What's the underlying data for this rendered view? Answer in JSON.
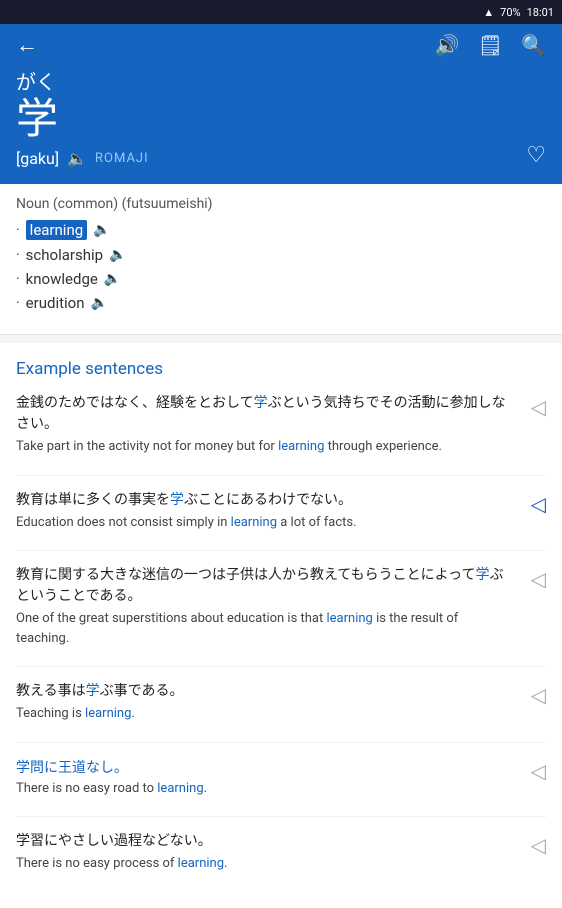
{
  "statusBar": {
    "wifi": "wifi",
    "battery": "70%",
    "time": "18:01"
  },
  "header": {
    "hiragana": "がく",
    "kanji": "学",
    "romaji_bracket": "[gaku]",
    "romaji_label": "ROMAJI"
  },
  "definitions": {
    "pos": "Noun (common) (futsuumeishi)",
    "items": [
      {
        "word": "learning",
        "highlight": true
      },
      {
        "word": "scholarship"
      },
      {
        "word": "knowledge"
      },
      {
        "word": "erudition"
      }
    ]
  },
  "examples": {
    "title": "Example sentences",
    "items": [
      {
        "jp": "金銭のためではなく、経験をとおして学ぶという気持ちでその活動に参加しなさい。",
        "en_pre": "Take part in the activity not for money but for ",
        "en_link": "learning",
        "en_post": " through experience.",
        "audio_active": false
      },
      {
        "jp": "教育は単に多くの事実を学ぶことにあるわけでない。",
        "en_pre": "Education does not consist simply in ",
        "en_link": "learning",
        "en_post": " a lot of facts.",
        "audio_active": true
      },
      {
        "jp": "教育に関する大きな迷信の一つは子供は人から教えてもらうことによって学ぶということである。",
        "en_pre": "One of the great superstitions about education is that ",
        "en_link": "learning",
        "en_post": " is the result of teaching.",
        "audio_active": false
      },
      {
        "jp": "教える事は学ぶ事である。",
        "en_pre": "Teaching is ",
        "en_link": "learning",
        "en_post": ".",
        "audio_active": false
      },
      {
        "jp_standalone": "学問に王道なし。",
        "en_pre": "There is no easy road to ",
        "en_link": "learning",
        "en_post": ".",
        "audio_active": false
      },
      {
        "jp": "学習にやさしい過程などない。",
        "en_pre": "There is no easy process of ",
        "en_link": "learning",
        "en_post": ".",
        "audio_active": false
      }
    ]
  },
  "icons": {
    "back": "←",
    "volume": "🔊",
    "document": "📄",
    "search": "🔍",
    "heart": "♡",
    "speaker": "🔈",
    "speaker_active": "🔊"
  }
}
